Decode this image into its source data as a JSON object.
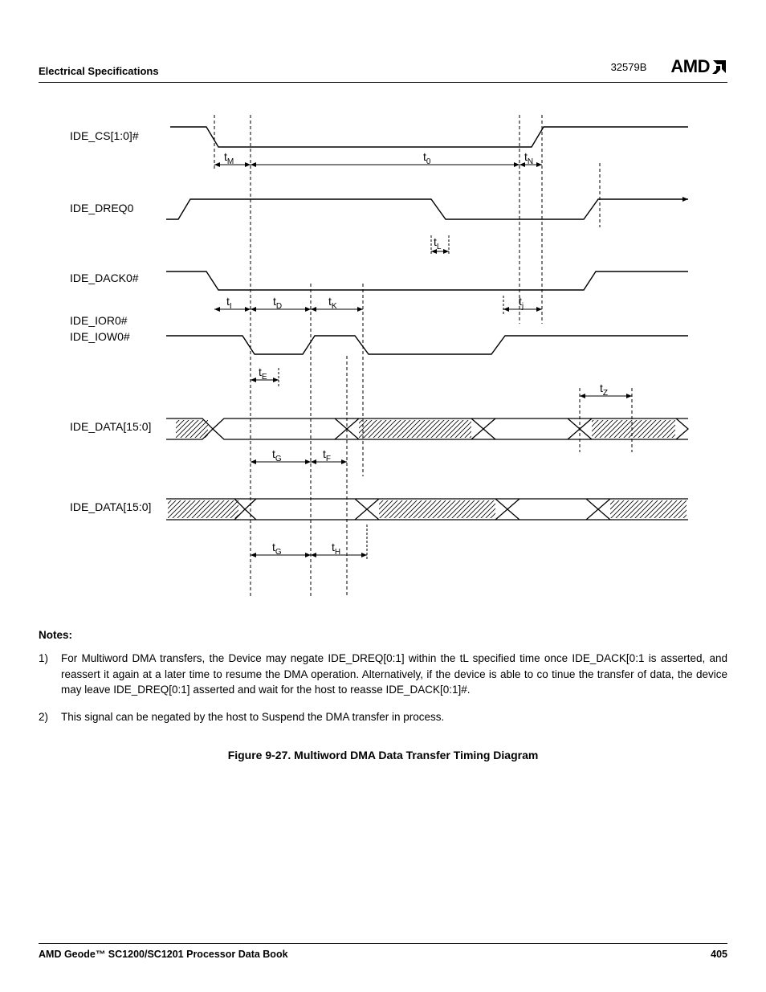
{
  "header": {
    "section": "Electrical Specifications",
    "doc_code": "32579B",
    "brand": "AMD"
  },
  "signals": {
    "s1": "IDE_CS[1:0]#",
    "s2": "IDE_DREQ0",
    "s3": "IDE_DACK0#",
    "s4": "IDE_IOR0#",
    "s5": "IDE_IOW0#",
    "s6": "IDE_DATA[15:0]",
    "s7": "IDE_DATA[15:0]"
  },
  "timing_labels": {
    "tM": "t",
    "tM_sub": "M",
    "t0": "t",
    "t0_sub": "0",
    "tN": "t",
    "tN_sub": "N",
    "tL": "t",
    "tL_sub": "L",
    "tI": "t",
    "tI_sub": "I",
    "tD": "t",
    "tD_sub": "D",
    "tK": "t",
    "tK_sub": "K",
    "tj": "t",
    "tj_sub": "j",
    "tE": "t",
    "tE_sub": "E",
    "tZ": "t",
    "tZ_sub": "Z",
    "tG": "t",
    "tG_sub": "G",
    "tF": "t",
    "tF_sub": "F",
    "tH": "t",
    "tH_sub": "H"
  },
  "notes": {
    "heading": "Notes:",
    "n1_num": "1)",
    "n1": "For Multiword DMA transfers, the Device may negate IDE_DREQ[0:1] within the tL specified time once IDE_DACK[0:1 is asserted, and reassert it again at a later time to resume the DMA operation. Alternatively, if the device is able to co tinue the transfer of data, the device may leave IDE_DREQ[0:1] asserted and wait for the host to reasse IDE_DACK[0:1]#.",
    "n2_num": "2)",
    "n2": "This signal can be negated by the host to Suspend the DMA transfer in process."
  },
  "figure_caption": "Figure 9-27.  Multiword DMA Data Transfer Timing Diagram",
  "footer": {
    "book": "AMD Geode™ SC1200/SC1201 Processor Data Book",
    "page": "405"
  },
  "chart_data": {
    "type": "timing-diagram",
    "title": "Multiword DMA Data Transfer Timing Diagram",
    "signals": [
      {
        "name": "IDE_CS[1:0]#",
        "transitions": [
          "high",
          "fall@t1",
          "low",
          "rise@t6"
        ]
      },
      {
        "name": "IDE_DREQ0",
        "transitions": [
          "low",
          "rise@t0",
          "high",
          "fall@t4b",
          "low",
          "rise@t6b",
          "high"
        ]
      },
      {
        "name": "IDE_DACK0#",
        "transitions": [
          "high",
          "fall@t1",
          "low",
          "rise@t6c"
        ]
      },
      {
        "name": "IDE_IOR0# / IDE_IOW0#",
        "transitions": [
          "high",
          "fall@t2",
          "low",
          "rise@t3",
          "high",
          "fall@t4",
          "low",
          "rise@t5",
          "high"
        ]
      },
      {
        "name": "IDE_DATA[15:0] (write)",
        "states": [
          "Z",
          "valid@t2b-t3b",
          "Z",
          "valid@t4b-t5b",
          "Z",
          "valid@t6b-end",
          "Z"
        ]
      },
      {
        "name": "IDE_DATA[15:0] (read)",
        "states": [
          "valid@start-t2",
          "Z",
          "valid@~t4-t5",
          "Z",
          "valid@t6-end"
        ]
      }
    ],
    "intervals": [
      {
        "label": "tM",
        "from": "CS# fall",
        "to": "first ref line"
      },
      {
        "label": "t0",
        "from": "first ref line",
        "to": "cycle end ref"
      },
      {
        "label": "tN",
        "from": "cycle end ref",
        "to": "CS# rise"
      },
      {
        "label": "tL",
        "from": "DREQ0 fall start",
        "to": "DREQ0 fall end"
      },
      {
        "label": "tI",
        "from": "DACK0# fall",
        "to": "first ref line"
      },
      {
        "label": "tD",
        "from": "first ref line",
        "to": "IOR/IOW fall"
      },
      {
        "label": "tK",
        "from": "IOR/IOW rise",
        "to": "next IOR/IOW fall"
      },
      {
        "label": "tj",
        "from": "last IOR/IOW rise",
        "to": "DACK0# rise"
      },
      {
        "label": "tE",
        "from": "IOR/IOW fall",
        "to": "data valid start (write)"
      },
      {
        "label": "tZ",
        "from": "last data end",
        "to": "bus tristate"
      },
      {
        "label": "tG",
        "from": "IOR/IOW fall",
        "to": "data valid (setup)"
      },
      {
        "label": "tF",
        "from": "IOR/IOW rise",
        "to": "data hold end (write)"
      },
      {
        "label": "tH",
        "from": "IOR/IOW rise",
        "to": "data hold end (read)"
      }
    ]
  }
}
